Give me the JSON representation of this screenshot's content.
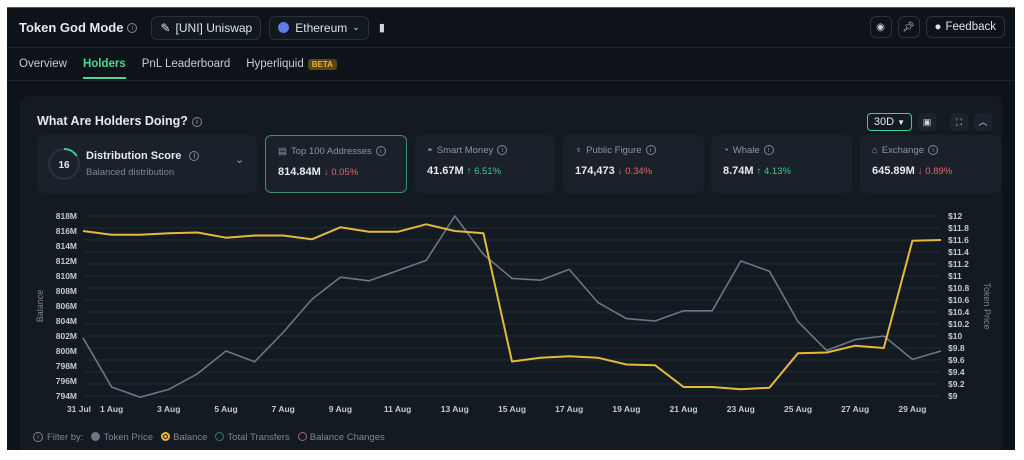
{
  "header": {
    "title": "Token God Mode",
    "token": "[UNI] Uniswap",
    "chain": "Ethereum",
    "feedback": "Feedback"
  },
  "tabs": [
    {
      "label": "Overview"
    },
    {
      "label": "Holders",
      "active": true
    },
    {
      "label": "PnL Leaderboard"
    },
    {
      "label": "Hyperliquid",
      "badge": "BETA"
    }
  ],
  "section": {
    "title": "What Are Holders Doing?",
    "range": "30D"
  },
  "distribution": {
    "score": "16",
    "score_fraction": 0.16,
    "label": "Distribution Score",
    "sub": "Balanced distribution"
  },
  "stats": [
    {
      "label": "Top 100 Addresses",
      "value": "814.84M",
      "change": "0.05%",
      "dir": "down",
      "selected": true,
      "icon": "wallet-icon"
    },
    {
      "label": "Smart Money",
      "value": "41.67M",
      "change": "6.51%",
      "dir": "up",
      "icon": "smart-money-icon"
    },
    {
      "label": "Public Figure",
      "value": "174,473",
      "change": "0.34%",
      "dir": "down",
      "icon": "public-figure-icon"
    },
    {
      "label": "Whale",
      "value": "8.74M",
      "change": "4.13%",
      "dir": "up",
      "icon": "whale-icon"
    },
    {
      "label": "Exchange",
      "value": "645.89M",
      "change": "0.89%",
      "dir": "down",
      "icon": "bank-icon"
    }
  ],
  "legend": {
    "filter": "Filter by:",
    "items": [
      "Token Price",
      "Balance",
      "Total Transfers",
      "Balance Changes"
    ]
  },
  "colors": {
    "balance": "#e5b93a",
    "price": "#6b7785",
    "accent": "#3ccf91",
    "down": "#e0676a",
    "up": "#42c989"
  },
  "chart_data": {
    "type": "line",
    "ylabel": "Balance",
    "y2label": "Token Price",
    "ylim": [
      794,
      818
    ],
    "y2lim": [
      9,
      12
    ],
    "yticks": [
      "818M",
      "816M",
      "814M",
      "812M",
      "810M",
      "808M",
      "806M",
      "804M",
      "802M",
      "800M",
      "798M",
      "796M",
      "794M"
    ],
    "y2ticks": [
      "$12",
      "$11.8",
      "$11.6",
      "$11.4",
      "$11.2",
      "$11",
      "$10.8",
      "$10.6",
      "$10.4",
      "$10.2",
      "$10",
      "$9.8",
      "$9.6",
      "$9.4",
      "$9.2",
      "$9"
    ],
    "xticks": [
      "31 Jul",
      "1 Aug",
      "3 Aug",
      "5 Aug",
      "7 Aug",
      "9 Aug",
      "11 Aug",
      "13 Aug",
      "15 Aug",
      "17 Aug",
      "19 Aug",
      "21 Aug",
      "23 Aug",
      "25 Aug",
      "27 Aug",
      "29 Aug"
    ],
    "x": [
      "31 Jul",
      "1 Aug",
      "2 Aug",
      "3 Aug",
      "4 Aug",
      "5 Aug",
      "6 Aug",
      "7 Aug",
      "8 Aug",
      "9 Aug",
      "10 Aug",
      "11 Aug",
      "12 Aug",
      "13 Aug",
      "14 Aug",
      "15 Aug",
      "16 Aug",
      "17 Aug",
      "18 Aug",
      "19 Aug",
      "20 Aug",
      "21 Aug",
      "22 Aug",
      "23 Aug",
      "24 Aug",
      "25 Aug",
      "26 Aug",
      "27 Aug",
      "28 Aug",
      "29 Aug",
      "30 Aug"
    ],
    "series": [
      {
        "name": "Balance",
        "axis": "left",
        "values": [
          816,
          815.5,
          815.5,
          815.7,
          815.8,
          815.1,
          815.4,
          815.4,
          814.9,
          816.5,
          815.9,
          815.9,
          816.9,
          816,
          815.7,
          798.6,
          799.1,
          799.3,
          799.1,
          798.2,
          798.1,
          795.2,
          795.2,
          794.9,
          795.1,
          799.7,
          799.8,
          800.7,
          800.4,
          814.7,
          814.8
        ]
      },
      {
        "name": "Token Price",
        "axis": "right",
        "values": [
          9.97,
          9.15,
          8.98,
          9.11,
          9.37,
          9.75,
          9.57,
          10.06,
          10.61,
          10.98,
          10.92,
          11.09,
          11.26,
          12.0,
          11.36,
          10.96,
          10.93,
          11.11,
          10.56,
          10.29,
          10.25,
          10.42,
          10.42,
          11.25,
          11.08,
          10.24,
          9.76,
          9.94,
          10.0,
          9.61,
          9.75
        ]
      }
    ],
    "grid": true
  }
}
